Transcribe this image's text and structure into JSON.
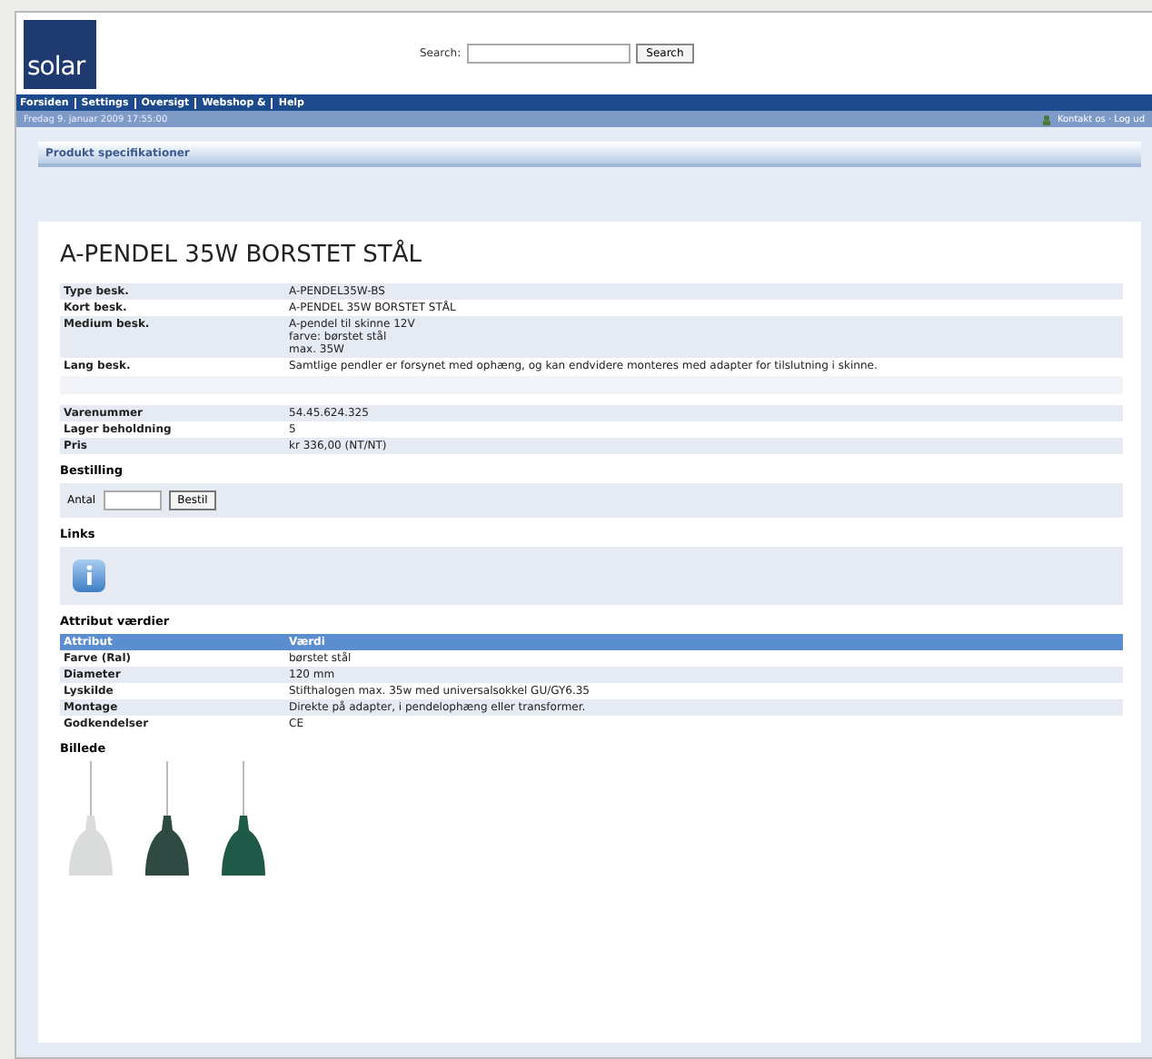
{
  "header": {
    "logo": "solar",
    "search": {
      "label": "Search:",
      "button": "Search"
    }
  },
  "nav": {
    "items": [
      "Forsiden",
      "Settings",
      "Oversigt",
      "Webshop &",
      "Help"
    ],
    "date": "Fredag 9. januar 2009 17:55:00",
    "right_links": "Kontakt os · Log ud"
  },
  "section_title": "Produkt specifikationer",
  "product": {
    "title": "A-PENDEL 35W BORSTET STÅL",
    "descriptions": [
      {
        "label": "Type besk.",
        "lines": [
          "A-PENDEL35W-BS"
        ]
      },
      {
        "label": "Kort besk.",
        "lines": [
          "A-PENDEL 35W BORSTET STÅL"
        ]
      },
      {
        "label": "Medium besk.",
        "lines": [
          "A-pendel til skinne 12V",
          "farve: børstet stål",
          "max. 35W"
        ]
      },
      {
        "label": "Lang besk.",
        "lines": [
          "Samtlige pendler er forsynet med ophæng, og kan endvidere monteres med adapter for tilslutning i skinne."
        ]
      }
    ],
    "details": [
      {
        "label": "Varenummer",
        "value": "54.45.624.325"
      },
      {
        "label": "Lager beholdning",
        "value": "5"
      },
      {
        "label": "Pris",
        "value": "kr 336,00 (NT/NT)"
      }
    ],
    "order": {
      "heading": "Bestilling",
      "quantity_label": "Antal",
      "button": "Bestil"
    },
    "links": {
      "heading": "Links"
    },
    "attributes": {
      "heading": "Attribut værdier",
      "columns": [
        "Attribut",
        "Værdi"
      ],
      "rows": [
        {
          "name": "Farve (Ral)",
          "value": "børstet stål"
        },
        {
          "name": "Diameter",
          "value": "120 mm"
        },
        {
          "name": "Lyskilde",
          "value": "Stifthalogen max. 35w med universalsokkel GU/GY6.35"
        },
        {
          "name": "Montage",
          "value": "Direkte på adapter, i pendelophæng eller transformer."
        },
        {
          "name": "Godkendelser",
          "value": "CE"
        }
      ]
    },
    "images": {
      "heading": "Billede",
      "items": [
        {
          "color": "#d9dcda"
        },
        {
          "color": "#2f4a42"
        },
        {
          "color": "#1f5a48"
        }
      ]
    }
  }
}
